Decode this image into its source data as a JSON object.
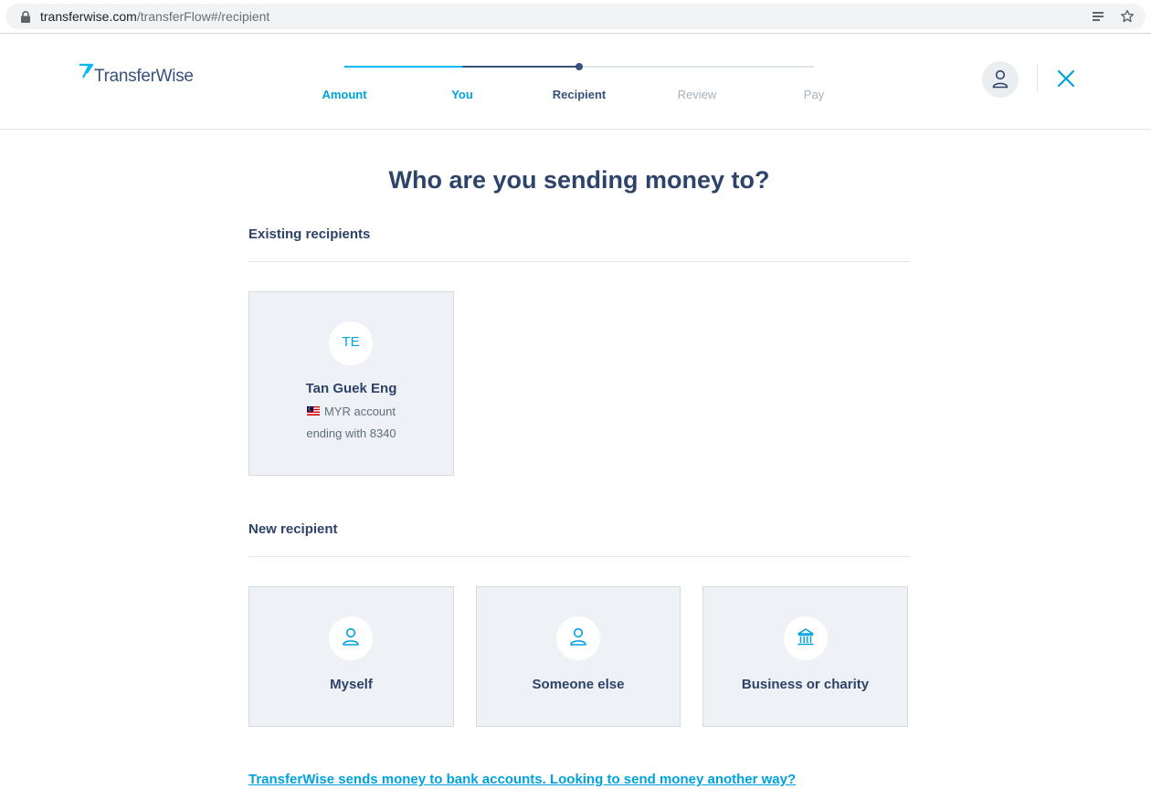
{
  "browser": {
    "url_domain": "transferwise.com",
    "url_path": "/transferFlow#/recipient"
  },
  "header": {
    "logo_text": "TransferWise",
    "steps": [
      {
        "label": "Amount",
        "state": "done"
      },
      {
        "label": "You",
        "state": "done"
      },
      {
        "label": "Recipient",
        "state": "active"
      },
      {
        "label": "Review",
        "state": "todo"
      },
      {
        "label": "Pay",
        "state": "todo"
      }
    ]
  },
  "main": {
    "title": "Who are you sending money to?",
    "existing_section": "Existing recipients",
    "existing_recipients": [
      {
        "initials": "TE",
        "name": "Tan Guek Eng",
        "account_line": "MYR account",
        "ending_line": "ending with 8340"
      }
    ],
    "new_section": "New recipient",
    "new_options": [
      {
        "label": "Myself",
        "icon": "person-icon"
      },
      {
        "label": "Someone else",
        "icon": "person-icon"
      },
      {
        "label": "Business or charity",
        "icon": "bank-icon"
      }
    ],
    "bottom_link": "TransferWise sends money to bank accounts. Looking to send money another way?"
  },
  "colors": {
    "accent": "#00a2dd",
    "navy": "#2e4369",
    "card_bg": "#eef1f5"
  }
}
